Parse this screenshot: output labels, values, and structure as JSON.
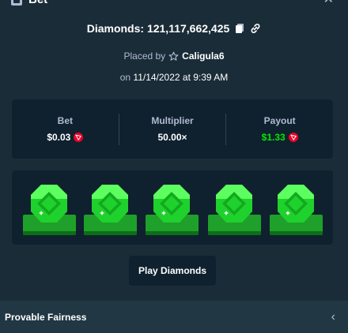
{
  "modal": {
    "title": "Bet",
    "close_glyph": "✕"
  },
  "header": {
    "game_label": "Diamonds: 121,117,662,425",
    "copy_icon": "copy-icon",
    "link_icon": "link-icon"
  },
  "placed": {
    "prefix": "Placed by",
    "user": "Caligula6",
    "star_icon": "star-outline-icon",
    "date_prefix": "on",
    "date": "11/14/2022 at 9:39 AM"
  },
  "stats": {
    "bet_label": "Bet",
    "bet_value": "$0.03",
    "multiplier_label": "Multiplier",
    "multiplier_value": "50.00×",
    "payout_label": "Payout",
    "payout_value": "$1.33",
    "currency_icon": "trx-icon",
    "payout_color": "#00e701"
  },
  "gems": {
    "count": 5,
    "color": "#1fa02a"
  },
  "actions": {
    "play_label": "Play Diamonds"
  },
  "fairness": {
    "label": "Provable Fairness",
    "chevron": "‹"
  }
}
